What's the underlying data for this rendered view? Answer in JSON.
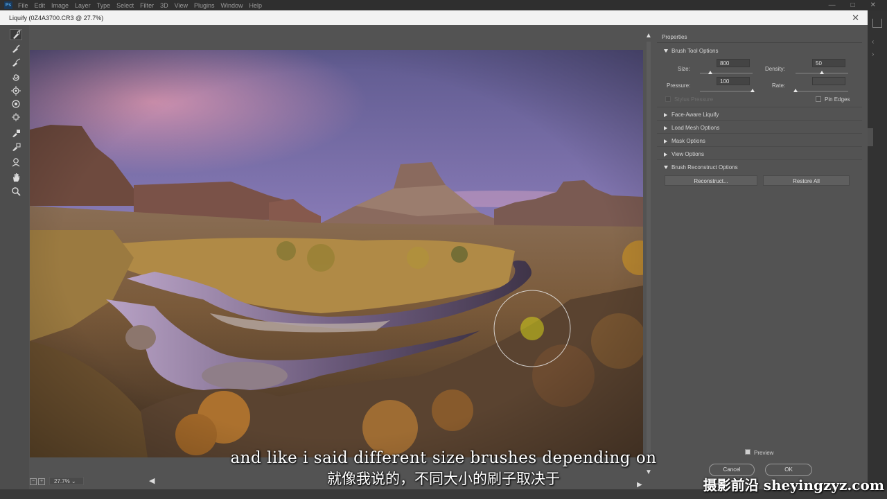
{
  "app": {
    "logo": "Ps",
    "menu": [
      "File",
      "Edit",
      "Image",
      "Layer",
      "Type",
      "Select",
      "Filter",
      "3D",
      "View",
      "Plugins",
      "Window",
      "Help"
    ],
    "window_controls": [
      "—",
      "□",
      "✕"
    ]
  },
  "dialog": {
    "title": "Liquify (0Z4A3700.CR3 @ 27.7%)",
    "close": "✕"
  },
  "tools": [
    {
      "name": "forward-warp-tool",
      "active": true
    },
    {
      "name": "reconstruct-tool"
    },
    {
      "name": "smooth-tool"
    },
    {
      "name": "twirl-clockwise-tool"
    },
    {
      "name": "pucker-tool"
    },
    {
      "name": "bloat-tool"
    },
    {
      "name": "push-left-tool"
    },
    {
      "name": "freeze-mask-tool"
    },
    {
      "name": "thaw-mask-tool"
    },
    {
      "name": "face-tool"
    },
    {
      "name": "hand-tool"
    },
    {
      "name": "zoom-tool"
    }
  ],
  "canvas": {
    "zoom": "27.7%"
  },
  "properties": {
    "title": "Properties",
    "brush_tool_options": {
      "label": "Brush Tool Options",
      "size_label": "Size:",
      "size_value": "800",
      "size_fraction": 0.2,
      "density_label": "Density:",
      "density_value": "50",
      "density_fraction": 0.5,
      "pressure_label": "Pressure:",
      "pressure_value": "100",
      "pressure_fraction": 1.0,
      "rate_label": "Rate:",
      "rate_value": "",
      "rate_fraction": 0.0,
      "stylus_label": "Stylus Pressure",
      "pin_edges_label": "Pin Edges"
    },
    "sections": [
      "Face-Aware Liquify",
      "Load Mesh Options",
      "Mask Options",
      "View Options"
    ],
    "brush_reconstruct": {
      "label": "Brush Reconstruct Options",
      "reconstruct_button": "Reconstruct...",
      "restore_all_button": "Restore All"
    },
    "preview_label": "Preview",
    "cancel_label": "Cancel",
    "ok_label": "OK"
  },
  "subtitles": {
    "english": "and like i said different size brushes depending on",
    "chinese": "就像我说的，不同大小的刷子取决于"
  },
  "watermark": "摄影前沿 sheyingzyz.com",
  "colors": {
    "dialog_bg": "#535353",
    "toolbar_bg": "#4d4d4d",
    "titlebar_bg": "#f2f2f2"
  }
}
